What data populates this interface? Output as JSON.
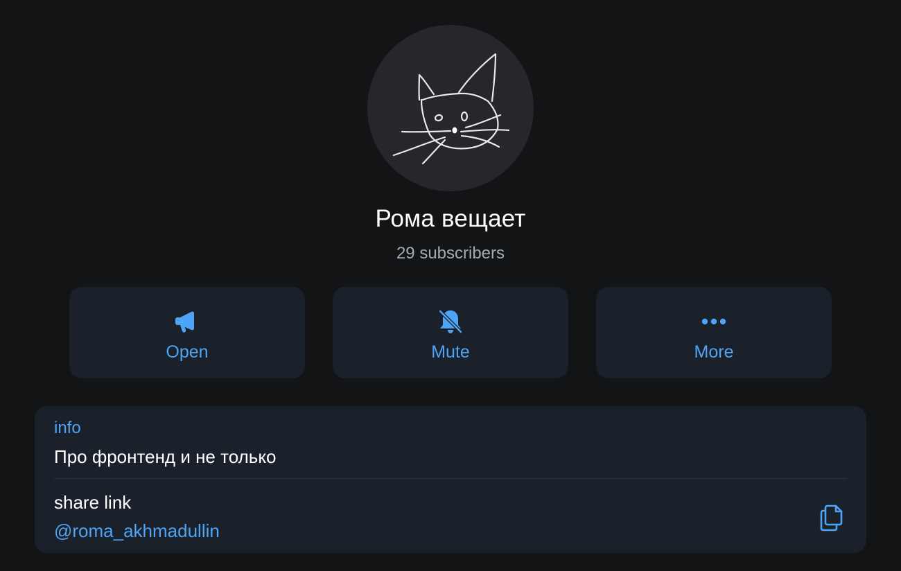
{
  "channel": {
    "name": "Рома вещает",
    "subscribers": "29 subscribers",
    "avatar_icon": "cat-drawing-avatar"
  },
  "actions": [
    {
      "label": "Open",
      "icon": "megaphone-icon"
    },
    {
      "label": "Mute",
      "icon": "bell-off-icon"
    },
    {
      "label": "More",
      "icon": "more-dots-icon"
    }
  ],
  "info": {
    "label": "info",
    "text": "Про фронтенд и не только",
    "share_label": "share link",
    "share_value": "@roma_akhmadullin",
    "copy_icon": "copy-icon"
  },
  "colors": {
    "background": "#131416",
    "card": "#1b212a",
    "accent": "#4ea4f5",
    "muted_text": "#a4abb3",
    "avatar_bg": "#26272b"
  }
}
